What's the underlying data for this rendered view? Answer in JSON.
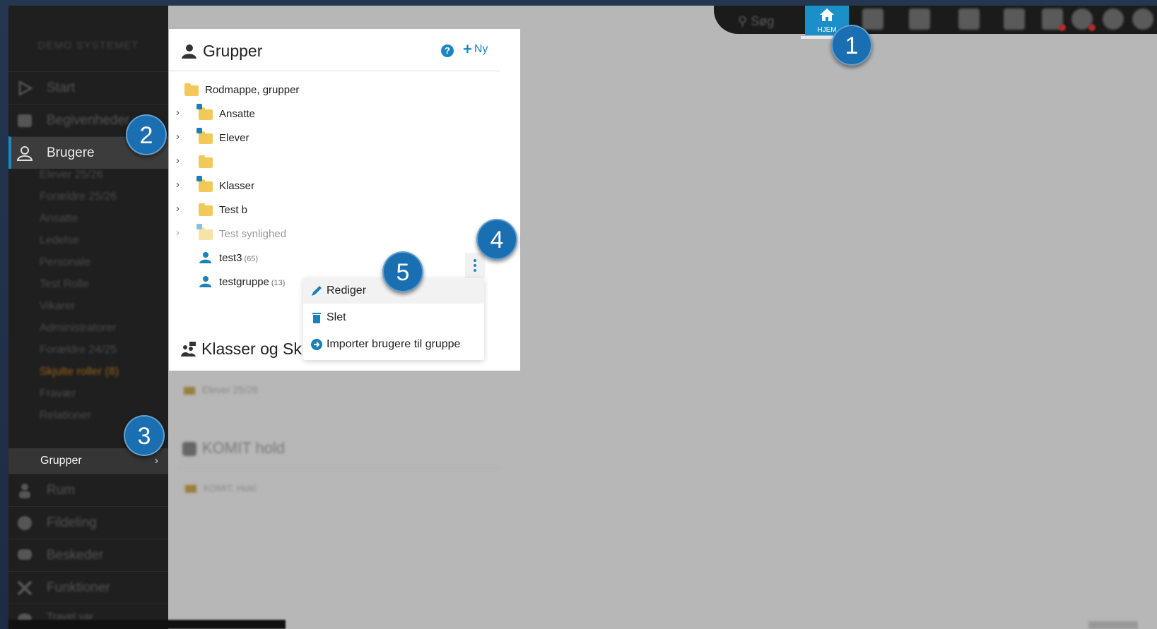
{
  "sidebar": {
    "system_name": "DEMO SYSTEMET",
    "nav": [
      {
        "label": "Start",
        "icon": "play-icon"
      },
      {
        "label": "Begivenheder",
        "icon": "calendar-icon"
      },
      {
        "label": "Brugere",
        "icon": "user-icon"
      },
      {
        "label": "Rum",
        "icon": "person-icon"
      },
      {
        "label": "Fildeling",
        "icon": "share-icon"
      },
      {
        "label": "Beskeder",
        "icon": "chat-icon"
      },
      {
        "label": "Funktioner",
        "icon": "tools-icon"
      },
      {
        "label": "Travel var",
        "icon": "cloud-icon"
      }
    ],
    "sub_items": [
      "Elever 25/26",
      "Forældre 25/26",
      "Ansatte",
      "Ledelse",
      "Personale",
      "Test Rolle",
      "Vikarer",
      "Administratorer",
      "Forældre 24/25",
      "Skjulte roller (8)",
      "Fravær",
      "Relationer"
    ],
    "active_sub": "Grupper"
  },
  "toolbar": {
    "search_label": "Søg",
    "home_label": "HJEM"
  },
  "groups_panel": {
    "title": "Grupper",
    "help": "?",
    "new_label": "Ny",
    "tree": [
      {
        "label": "Rodmappe, grupper"
      },
      {
        "label": "Ansatte"
      },
      {
        "label": "Elever"
      },
      {
        "label": ""
      },
      {
        "label": "Klasser"
      },
      {
        "label": "Test b"
      },
      {
        "label": "Test synlighed"
      },
      {
        "label": "test3",
        "count": "(65)"
      },
      {
        "label": "testgruppe",
        "count": "(13)"
      }
    ],
    "section2_title": "Klasser og Sk"
  },
  "context_menu": {
    "items": [
      {
        "label": "Rediger",
        "icon": "pencil-icon"
      },
      {
        "label": "Slet",
        "icon": "trash-icon"
      },
      {
        "label": "Importer brugere til gruppe",
        "icon": "import-icon"
      }
    ]
  },
  "background_sections": {
    "klasser_item": "Elever 25/26",
    "komit_title": "KOMIT hold",
    "komit_item": "KOMIT, Hold"
  },
  "callouts": [
    "1",
    "2",
    "3",
    "4",
    "5"
  ],
  "colors": {
    "accent": "#1c86c4",
    "sidebar_bg": "#1f1f1f",
    "callout": "#1a6fb3",
    "folder": "#f2c85b"
  }
}
